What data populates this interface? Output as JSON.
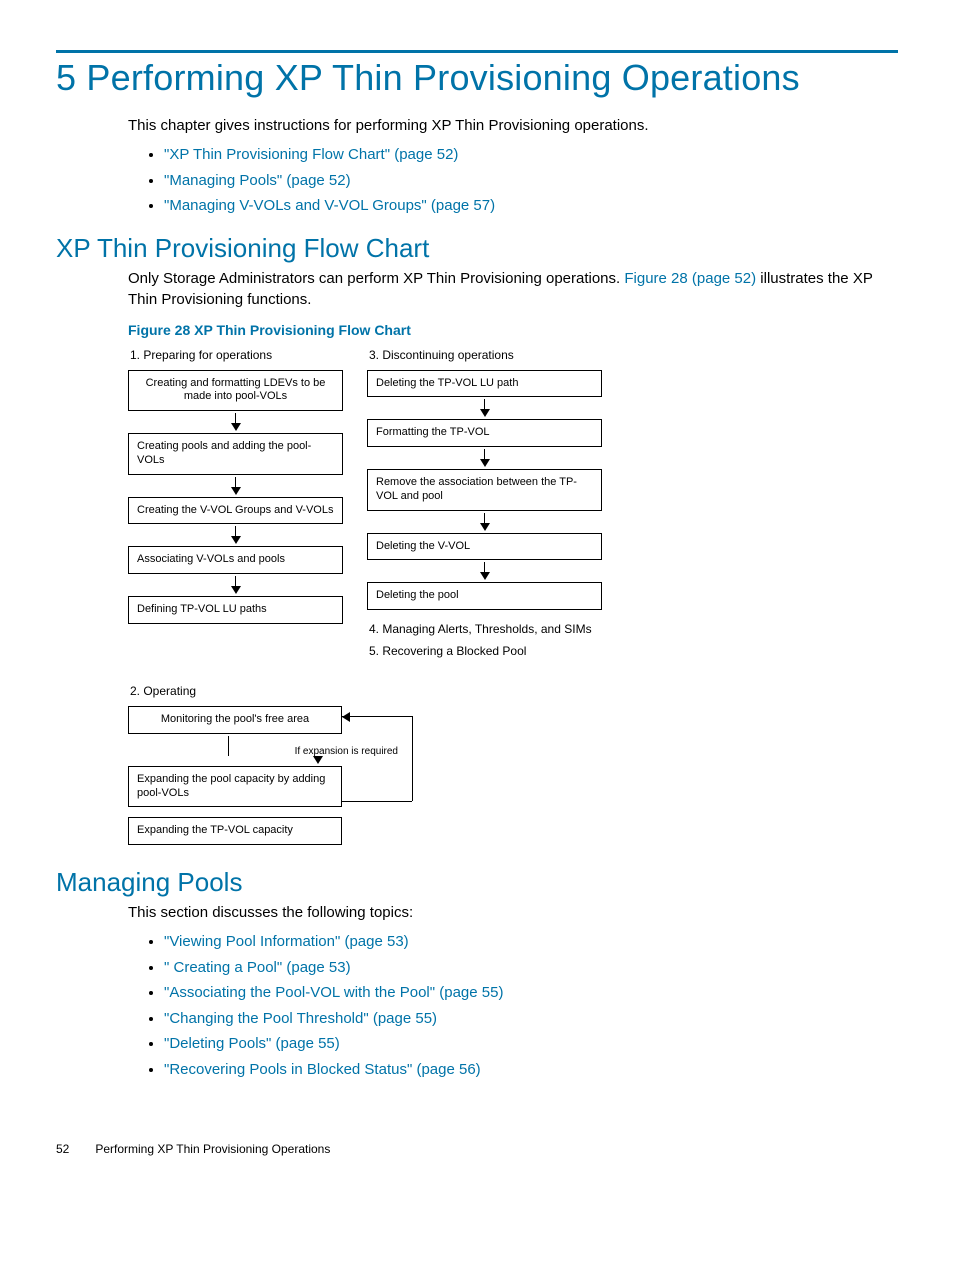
{
  "chapter": {
    "title": "5 Performing XP Thin Provisioning Operations",
    "intro": "This chapter gives instructions for performing XP Thin Provisioning operations.",
    "top_links": [
      "\"XP Thin Provisioning Flow Chart\" (page 52)",
      "\"Managing Pools\" (page 52)",
      "\"Managing V-VOLs and V-VOL Groups\" (page 57)"
    ]
  },
  "section_flowchart": {
    "title": "XP Thin Provisioning Flow Chart",
    "para_pre": "Only Storage Administrators can perform XP Thin Provisioning operations. ",
    "fig_ref": "Figure 28 (page 52)",
    "para_post": " illustrates the XP Thin Provisioning functions.",
    "figure_caption": "Figure 28 XP Thin Provisioning Flow Chart"
  },
  "flowchart": {
    "col1_label": "1. Preparing for operations",
    "col1_boxes": {
      "b1": "Creating and formatting LDEVs to be made into pool-VOLs",
      "b2": "Creating pools and adding the pool-VOLs",
      "b3": "Creating the V-VOL Groups and V-VOLs",
      "b4": "Associating V-VOLs and pools",
      "b5": "Defining TP-VOL LU paths"
    },
    "col3_label": "3. Discontinuing operations",
    "col3_boxes": {
      "b1": "Deleting the TP-VOL LU path",
      "b2": "Formatting the TP-VOL",
      "b3": "Remove the association between the TP-VOL and pool",
      "b4": "Deleting the V-VOL",
      "b5": "Deleting the pool"
    },
    "col4_label": "4. Managing Alerts, Thresholds, and SIMs",
    "col5_label": "5. Recovering a Blocked Pool",
    "col2_label": "2. Operating",
    "col2_boxes": {
      "b1": "Monitoring the pool's free area",
      "if_exp": "If expansion is required",
      "b2": "Expanding the pool capacity by adding pool-VOLs",
      "b3": "Expanding the TP-VOL capacity"
    }
  },
  "section_pools": {
    "title": "Managing Pools",
    "intro": "This section discusses the following topics:",
    "links": [
      "\"Viewing Pool Information\" (page 53)",
      "\" Creating a Pool\" (page 53)",
      "\"Associating the Pool-VOL with the Pool\" (page 55)",
      "\"Changing the Pool Threshold\" (page 55)",
      "\"Deleting Pools\" (page 55)",
      "\"Recovering Pools in Blocked Status\" (page 56)"
    ]
  },
  "footer": {
    "page_num": "52",
    "running": "Performing XP Thin Provisioning Operations"
  }
}
